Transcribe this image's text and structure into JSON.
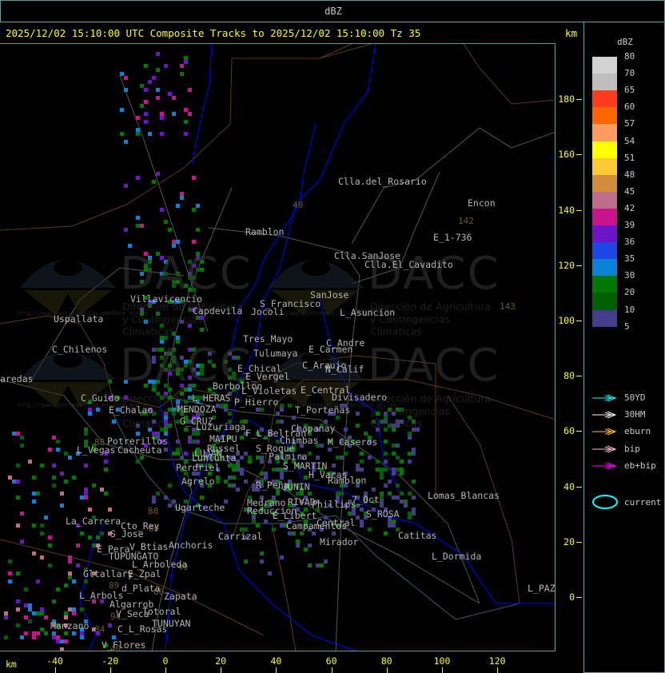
{
  "header": {
    "title": "dBZ"
  },
  "title_bar": {
    "text": "2025/12/02 15:10:00 UTC Composite Tracks to 2025/12/02 15:10:00 Tz 35",
    "unit": "km"
  },
  "axes": {
    "x_label": "km",
    "x_ticks": [
      "-40",
      "-20",
      "0",
      "20",
      "40",
      "60",
      "80",
      "100",
      "120"
    ],
    "y_ticks": [
      "0",
      "20",
      "40",
      "60",
      "80",
      "100",
      "120",
      "140",
      "160",
      "180"
    ]
  },
  "legend": {
    "title": "dBZ",
    "labels": [
      "80",
      "70",
      "65",
      "60",
      "57",
      "54",
      "51",
      "48",
      "45",
      "42",
      "39",
      "36",
      "35",
      "30",
      "20",
      "10",
      "5"
    ],
    "colors": [
      "#d2d2d2",
      "#bebebe",
      "#ff3c1e",
      "#ff6400",
      "#ff9b5f",
      "#ffff00",
      "#fac832",
      "#d28c3c",
      "#be6e8c",
      "#c8148c",
      "#6e14c8",
      "#1e46e6",
      "#0a82d8",
      "#007800",
      "#005f00",
      "#463c8c"
    ],
    "tracks": [
      {
        "label": "50YD",
        "color": "#00ffff"
      },
      {
        "label": "30HM",
        "color": "#ffffff"
      },
      {
        "label": "eburn",
        "color": "#ffc800"
      },
      {
        "label": "bip",
        "color": "#ffc0cb"
      },
      {
        "label": "eb+bip",
        "color": "#ff00ff"
      }
    ],
    "current": {
      "label": "current",
      "color": "#00ffff"
    }
  },
  "watermark": {
    "logo": "DACC",
    "line1": "Dirección de Agricultura",
    "line2": "y Contingencias Climáticas",
    "url": "http://www.contingencias.mendoza.gov.ar"
  },
  "places": [
    "Clla.del_Rosario",
    "Encon",
    "E_1-736",
    "Ramblon",
    "Clla.SanJose",
    "Clla.El_Cavadito",
    "Villavicencio",
    "Capdevila",
    "S_Francisco",
    "SanJose",
    "Jocoli",
    "L_Asuncion",
    "Uspallata",
    "Tres_Mayo",
    "C_Andre",
    "E_Carmen",
    "Tulumaya",
    "C_Chilenos",
    "C_Araujo",
    "N_Calif",
    "E_Chical",
    "E_Vergel",
    "aredas",
    "Borbollon",
    "L_Violetas",
    "E_Central",
    "Divisadero",
    "P_Hierro",
    "C_Guido",
    "L_HERAS",
    "E_Chalao",
    "MENDOZA",
    "T_Porteñas",
    "G_CRUZ",
    "Luzuriaga",
    "Chapanay",
    "F_L_Beltran",
    "MAIPU",
    "Chimbas",
    "M_Caseros",
    "Potrerillos",
    "Russel",
    "S_Roque",
    "L_Vegas",
    "Cacheuta",
    "Palmira",
    "LUJAN",
    "Lunlunta",
    "S_MARTIN",
    "Perdriel",
    "H_Vacas",
    "Ramblon",
    "Agrelo",
    "R_Peña",
    "JUNIN",
    "Ugarteche",
    "7_Oct",
    "Medrano",
    "RIVAD",
    "Phillips",
    "Reduccion",
    "S_ROSA",
    "La_Carrera",
    "Lomas_Blancas",
    "E_Libert",
    "Cto_Rey",
    "Central",
    "Campamentos",
    "S_Jose",
    "Carrizal",
    "Catitas",
    "Anchoris",
    "V_Btias",
    "E_Pera",
    "TUPUNGATO",
    "L_Dormida",
    "Mirador",
    "L_Arboleda",
    "Gltallary",
    "E_Zpal",
    "d_Plata",
    "L_PAZ",
    "L_Arbols",
    "Zapata",
    "Algarrob",
    "V_Seca",
    "Totoral",
    "TUNUYAN",
    "Manzano",
    "C_L_Rosas",
    "V_Flores"
  ],
  "route_numbers": [
    "40",
    "142",
    "143",
    "88",
    "88",
    "86",
    "40",
    "89",
    "86",
    "94",
    "84",
    "40"
  ],
  "echo_colors": {
    "weak": "#463c8c",
    "light": "#005f00",
    "moderate": "#007800",
    "blue": "#0a82d8",
    "blue2": "#1e46e6",
    "violet": "#6e14c8",
    "magenta": "#c8148c",
    "pink": "#be6e8c",
    "orange": "#d28c3c"
  }
}
